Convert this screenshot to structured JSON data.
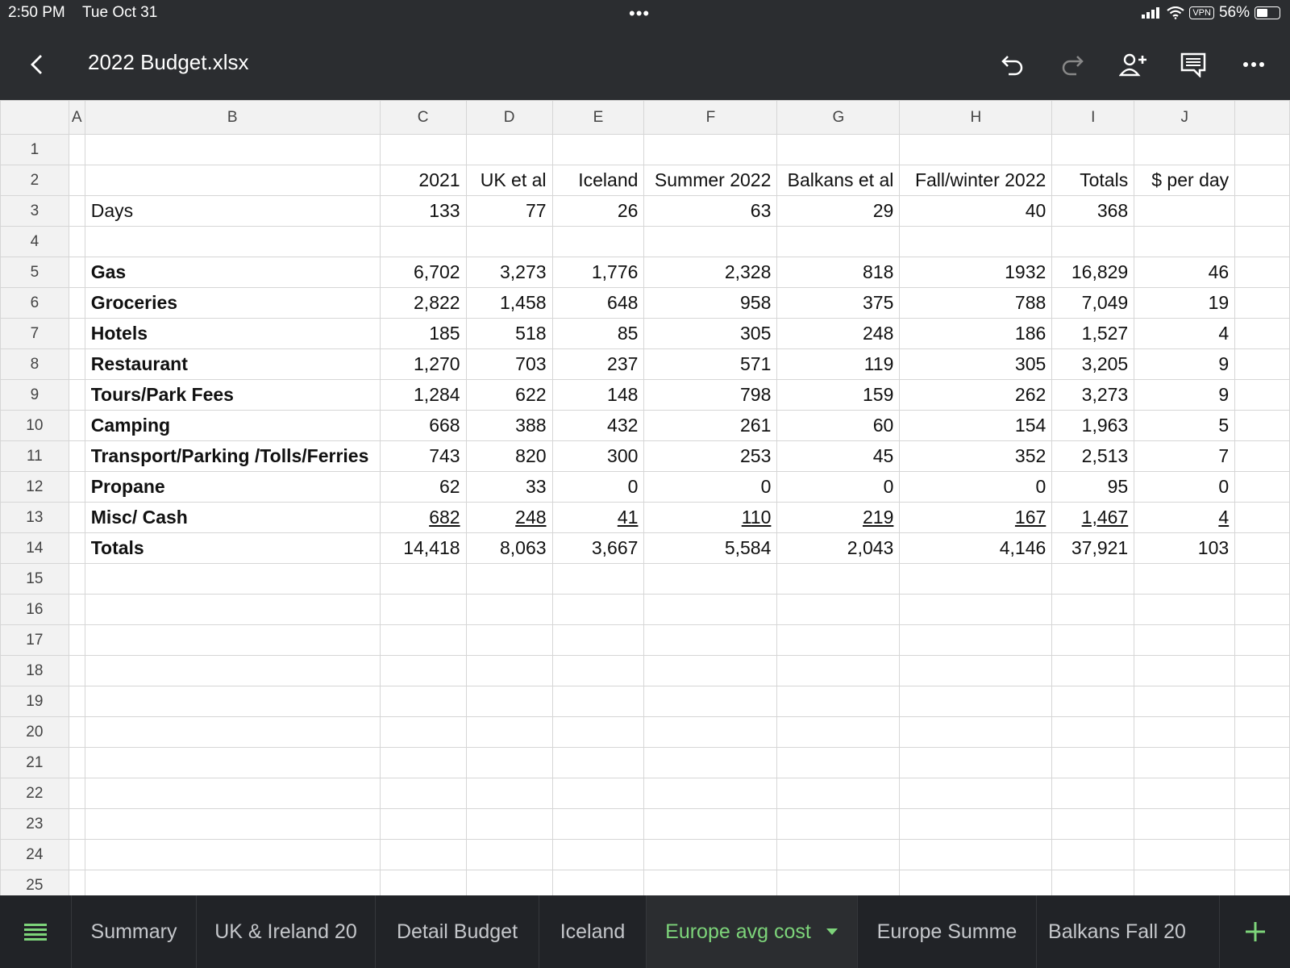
{
  "status_bar": {
    "time": "2:50 PM",
    "date": "Tue Oct 31",
    "vpn": "VPN",
    "battery": "56%",
    "battery_level": 0.56
  },
  "app_bar": {
    "title": "2022 Budget.xlsx"
  },
  "columns": [
    "A",
    "B",
    "C",
    "D",
    "E",
    "F",
    "G",
    "H",
    "I",
    "J"
  ],
  "rows": [
    {
      "n": "1",
      "cells": [
        "",
        "",
        "",
        "",
        "",
        "",
        "",
        "",
        "",
        ""
      ]
    },
    {
      "n": "2",
      "cells": [
        "",
        "",
        "2021",
        "UK et al",
        "Iceland",
        "Summer 2022",
        "Balkans et al",
        "Fall/winter 2022",
        "Totals",
        "$ per day"
      ]
    },
    {
      "n": "3",
      "cells": [
        "",
        "Days",
        "133",
        "77",
        "26",
        "63",
        "29",
        "40",
        "368",
        ""
      ]
    },
    {
      "n": "4",
      "cells": [
        "",
        "",
        "",
        "",
        "",
        "",
        "",
        "",
        "",
        ""
      ]
    },
    {
      "n": "5",
      "cells": [
        "",
        "Gas",
        "6,702",
        "3,273",
        "1,776",
        "2,328",
        "818",
        "1932",
        "16,829",
        "46"
      ]
    },
    {
      "n": "6",
      "cells": [
        "",
        "Groceries",
        "2,822",
        "1,458",
        "648",
        "958",
        "375",
        "788",
        "7,049",
        "19"
      ]
    },
    {
      "n": "7",
      "cells": [
        "",
        "Hotels",
        "185",
        "518",
        "85",
        "305",
        "248",
        "186",
        "1,527",
        "4"
      ]
    },
    {
      "n": "8",
      "cells": [
        "",
        "Restaurant",
        "1,270",
        "703",
        "237",
        "571",
        "119",
        "305",
        "3,205",
        "9"
      ]
    },
    {
      "n": "9",
      "cells": [
        "",
        "Tours/Park Fees",
        "1,284",
        "622",
        "148",
        "798",
        "159",
        "262",
        "3,273",
        "9"
      ]
    },
    {
      "n": "10",
      "cells": [
        "",
        "Camping",
        "668",
        "388",
        "432",
        "261",
        "60",
        "154",
        "1,963",
        "5"
      ]
    },
    {
      "n": "11",
      "cells": [
        "",
        "Transport/Parking /Tolls/Ferries",
        "743",
        "820",
        "300",
        "253",
        "45",
        "352",
        "2,513",
        "7"
      ]
    },
    {
      "n": "12",
      "cells": [
        "",
        "Propane",
        "62",
        "33",
        "0",
        "0",
        "0",
        "0",
        "95",
        "0"
      ]
    },
    {
      "n": "13",
      "cells": [
        "",
        "Misc/ Cash",
        "682",
        "248",
        "41",
        "110",
        "219",
        "167",
        "1,467",
        "4"
      ]
    },
    {
      "n": "14",
      "cells": [
        "",
        "Totals",
        "14,418",
        "8,063",
        "3,667",
        "5,584",
        "2,043",
        "4,146",
        "37,921",
        "103"
      ]
    },
    {
      "n": "15",
      "cells": [
        "",
        "",
        "",
        "",
        "",
        "",
        "",
        "",
        "",
        ""
      ]
    },
    {
      "n": "16",
      "cells": [
        "",
        "",
        "",
        "",
        "",
        "",
        "",
        "",
        "",
        ""
      ]
    },
    {
      "n": "17",
      "cells": [
        "",
        "",
        "",
        "",
        "",
        "",
        "",
        "",
        "",
        ""
      ]
    },
    {
      "n": "18",
      "cells": [
        "",
        "",
        "",
        "",
        "",
        "",
        "",
        "",
        "",
        ""
      ]
    },
    {
      "n": "19",
      "cells": [
        "",
        "",
        "",
        "",
        "",
        "",
        "",
        "",
        "",
        ""
      ]
    },
    {
      "n": "20",
      "cells": [
        "",
        "",
        "",
        "",
        "",
        "",
        "",
        "",
        "",
        ""
      ]
    },
    {
      "n": "21",
      "cells": [
        "",
        "",
        "",
        "",
        "",
        "",
        "",
        "",
        "",
        ""
      ]
    },
    {
      "n": "22",
      "cells": [
        "",
        "",
        "",
        "",
        "",
        "",
        "",
        "",
        "",
        ""
      ]
    },
    {
      "n": "23",
      "cells": [
        "",
        "",
        "",
        "",
        "",
        "",
        "",
        "",
        "",
        ""
      ]
    },
    {
      "n": "24",
      "cells": [
        "",
        "",
        "",
        "",
        "",
        "",
        "",
        "",
        "",
        ""
      ]
    },
    {
      "n": "25",
      "cells": [
        "",
        "",
        "",
        "",
        "",
        "",
        "",
        "",
        "",
        ""
      ]
    }
  ],
  "bold_rows": [
    "5",
    "6",
    "7",
    "8",
    "9",
    "10",
    "11",
    "12",
    "13",
    "14"
  ],
  "underlined_rows": [
    "13"
  ],
  "sheet_tabs": [
    {
      "label": "Summary",
      "active": false
    },
    {
      "label": "UK & Ireland 20",
      "active": false
    },
    {
      "label": "Detail Budget",
      "active": false
    },
    {
      "label": "Iceland",
      "active": false
    },
    {
      "label": "Europe avg cost",
      "active": true
    },
    {
      "label": "Europe Summe",
      "active": false
    },
    {
      "label": "Balkans Fall 20",
      "active": false
    }
  ],
  "colors": {
    "toolbar_bg": "#2b2d30",
    "tabbar_bg": "#212327",
    "active_tab": "#7dd47a",
    "header_bg": "#f2f2f2",
    "gridline": "#d6d6d6"
  }
}
